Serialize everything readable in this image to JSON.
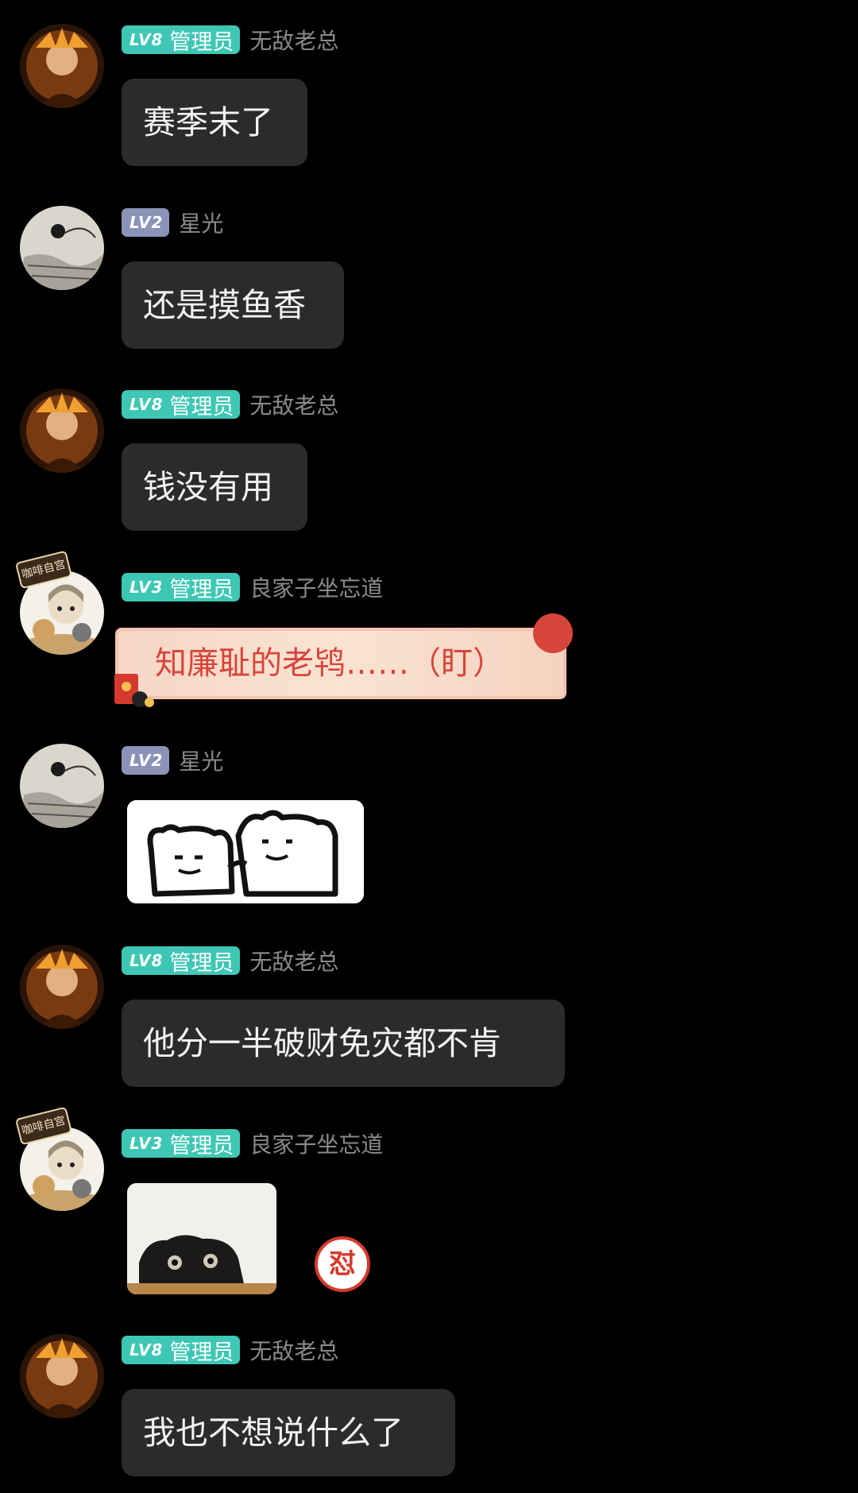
{
  "messages": [
    {
      "level": "LV8",
      "role": "管理员",
      "user": "无敌老总",
      "text": "赛季末了",
      "type": "text"
    },
    {
      "level": "LV2",
      "role": "",
      "user": "星光",
      "text": "还是摸鱼香",
      "type": "text"
    },
    {
      "level": "LV8",
      "role": "管理员",
      "user": "无敌老总",
      "text": "钱没有用",
      "type": "text"
    },
    {
      "level": "LV3",
      "role": "管理员",
      "user": "良家子坐忘道",
      "text": "知廉耻的老鸨……（盯）",
      "type": "fancy-text",
      "avatar_badge": "咖啡自宫"
    },
    {
      "level": "LV2",
      "role": "",
      "user": "星光",
      "type": "sticker",
      "sticker": "two-cats-sticker"
    },
    {
      "level": "LV8",
      "role": "管理员",
      "user": "无敌老总",
      "text": "他分一半破财免灾都不肯",
      "type": "text"
    },
    {
      "level": "LV3",
      "role": "管理员",
      "user": "良家子坐忘道",
      "type": "sticker",
      "sticker": "peeking-cat-sticker",
      "avatar_badge": "咖啡自宫",
      "reaction": "怼"
    },
    {
      "level": "LV8",
      "role": "管理员",
      "user": "无敌老总",
      "text": "我也不想说什么了",
      "type": "text"
    }
  ],
  "colors": {
    "background": "#000000",
    "bubble": "#2b2b2b",
    "admin_badge": "#3ec7b4",
    "plain_badge": "#8b93b8",
    "username": "#8a8a8a",
    "fancy_text": "#d8453a"
  }
}
